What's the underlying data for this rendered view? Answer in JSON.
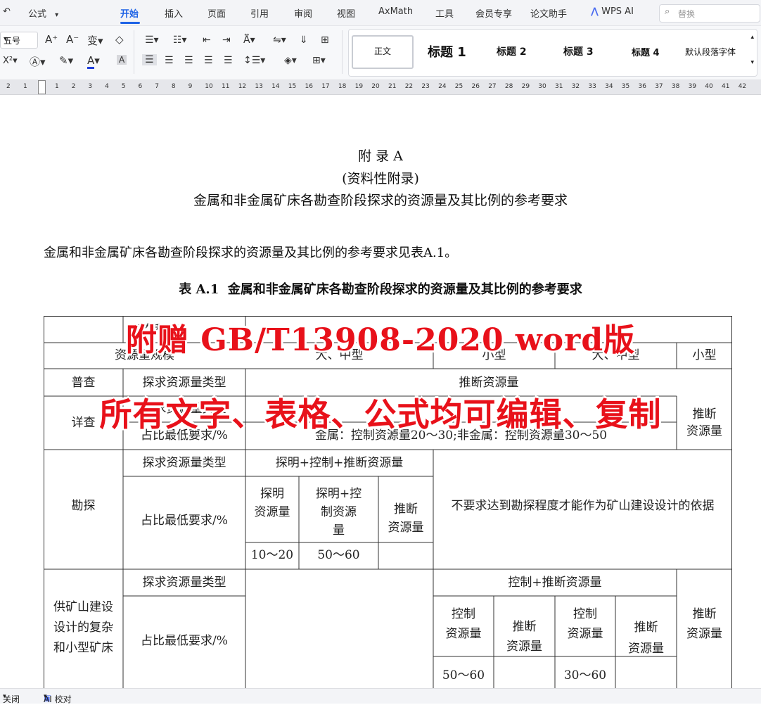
{
  "menubar": {
    "format_label": "公式",
    "tabs": [
      "开始",
      "插入",
      "页面",
      "引用",
      "审阅",
      "视图",
      "AxMath",
      "工具",
      "会员专享",
      "论文助手",
      "WPS AI"
    ],
    "active_tab": "开始",
    "search_placeholder": "替换"
  },
  "ribbon": {
    "font_size": "五号",
    "styles": [
      "正文",
      "标题 1",
      "标题 2",
      "标题 3",
      "标题 4",
      "默认段落字体"
    ]
  },
  "ruler": {
    "numbers": [
      "2",
      "1",
      "1",
      "2",
      "3",
      "4",
      "5",
      "6",
      "7",
      "8",
      "9",
      "10",
      "11",
      "12",
      "13",
      "14",
      "15",
      "16",
      "17",
      "18",
      "19",
      "20",
      "21",
      "22",
      "23",
      "24",
      "25",
      "26",
      "27",
      "28",
      "29",
      "30",
      "31",
      "32",
      "33",
      "34",
      "35",
      "36",
      "37",
      "38",
      "39",
      "40",
      "41",
      "42"
    ]
  },
  "doc": {
    "appendix_title": "附 录 A",
    "appendix_type": "(资料性附录)",
    "appendix_subtitle": "金属和非金属矿床各勘查阶段探求的资源量及其比例的参考要求",
    "body_text": "金属和非金属矿床各勘查阶段探求的资源量及其比例的参考要求见表A.1。",
    "table_caption_prefix": "表 A.1",
    "table_caption": "金属和非金属矿床各勘查阶段探求的资源量及其比例的参考要求",
    "table": {
      "r1_c1": "复杂程度",
      "r2_c1": "资源量规模",
      "r2_c2": "大、中型",
      "r2_c3": "小型",
      "r2_c4": "大、中型",
      "r2_c5": "小型",
      "puca": "普查",
      "puca_type": "探求资源量类型",
      "puca_value": "推断资源量",
      "xiangca": "详查",
      "xiangca_type": "探求资源量类型",
      "xiangca_ratio": "占比最低要求/%",
      "xiangca_ratio_value": "金属：控制资源量20～30;非金属：控制资源量30～50",
      "xiangca_right": "推断资源量",
      "kantan": "勘探",
      "kantan_type": "探求资源量类型",
      "kantan_type_value": "探明+控制+推断资源量",
      "kantan_ratio": "占比最低要求/%",
      "kantan_sub1": "探明资源量",
      "kantan_sub2": "探明+控制资源量",
      "kantan_sub3": "推断资源量",
      "kantan_val1": "10～20",
      "kantan_val2": "50～60",
      "kantan_right": "不要求达到勘探程度才能作为矿山建设设计的依据",
      "gong": "供矿山建设设计的复杂和小型矿床",
      "gong_type": "探求资源量类型",
      "gong_ratio": "占比最低要求/%",
      "gong_type_value": "控制+推断资源量",
      "gong_sub1": "控制资源量",
      "gong_sub2": "推断资源量",
      "gong_sub3": "控制资源量",
      "gong_sub4": "推断资源量",
      "gong_val1": "50～60",
      "gong_val2": "30～60",
      "gong_right": "推断资源量"
    }
  },
  "overlay": {
    "line1": "附赠 GB/T13908-2020 word版",
    "line2": "所有文字、表格、公式均可编辑、复制"
  },
  "statusbar": {
    "close": "关闭",
    "ai_check": "AI 校对"
  },
  "colors": {
    "accent": "#1f63e6",
    "overlay_red": "#e8111a"
  }
}
